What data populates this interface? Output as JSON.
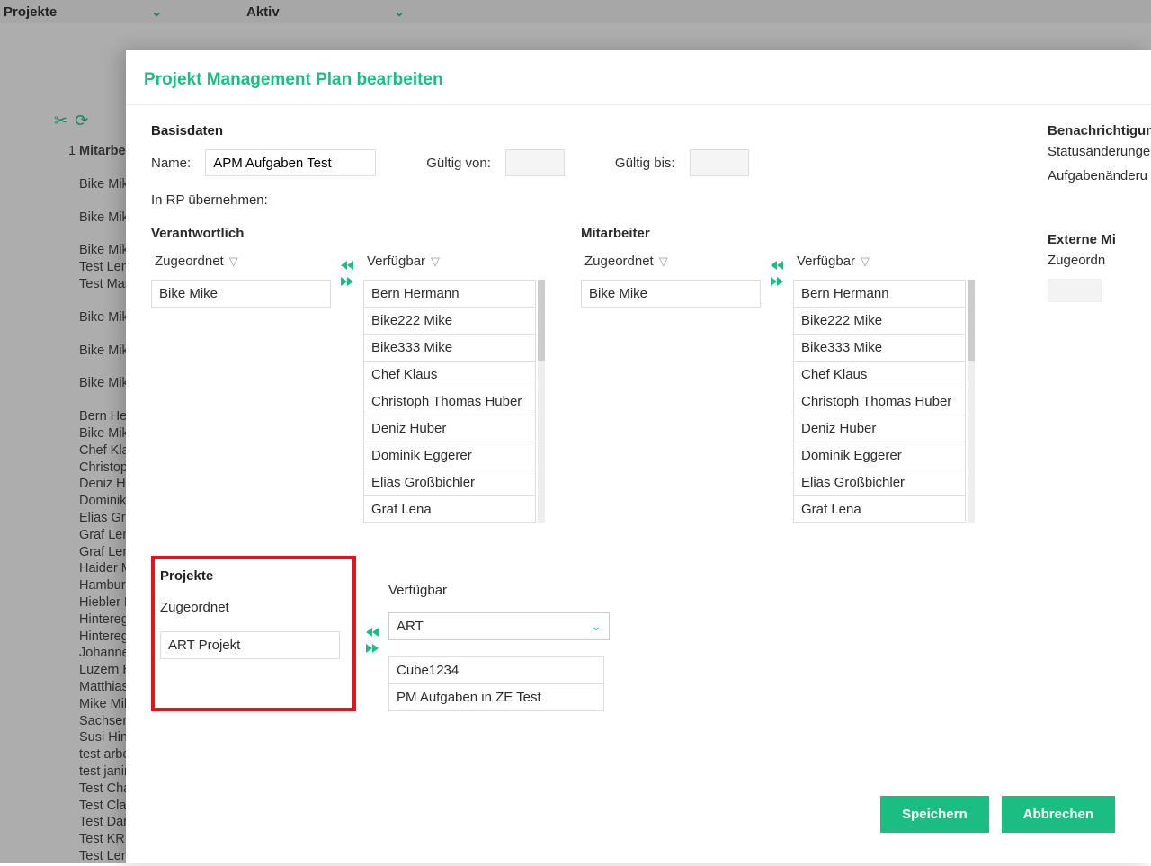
{
  "bg": {
    "dropdown1": "Projekte",
    "dropdown2": "Aktiv",
    "marker": "1",
    "header": "Mitarbeit",
    "rows1": [
      "Bike Mik",
      "",
      "Bike Mik",
      "",
      "Bike Mik",
      "Test Len",
      "Test Mar",
      "",
      "Bike Mik",
      "",
      "Bike Mik",
      "",
      "Bike Mik"
    ],
    "rows2": [
      "Bern Her",
      "Bike Mik",
      "Chef Kla",
      "Christop",
      "Deniz Hu",
      "Dominik",
      "Elias Gro",
      "Graf Len",
      "Graf Len",
      "Haider M",
      "Hamburg",
      "Hiebler D",
      "Hintereg",
      "Hintereg",
      "Johannes",
      "Luzern H",
      "Matthias",
      "Mike Mik",
      "Sachsen",
      "Susi Hin",
      "test arbe",
      "test janir",
      "Test Cha",
      "Test Clau",
      "Test Dar",
      "Test KR",
      "Test Lena"
    ]
  },
  "modal": {
    "title": "Projekt Management Plan bearbeiten",
    "basis": {
      "heading": "Basisdaten",
      "name_label": "Name:",
      "name_value": "APM Aufgaben Test",
      "valid_from_label": "Gültig von:",
      "valid_to_label": "Gültig bis:",
      "rp_label": "In RP übernehmen:"
    },
    "notif": {
      "heading": "Benachrichtigung",
      "line1": "Statusänderunge",
      "line2": "Aufgabenänderu",
      "heading2": "Externe Mi",
      "line3": "Zugeordn"
    },
    "verantwortlich": {
      "heading": "Verantwortlich",
      "assigned_label": "Zugeordnet",
      "available_label": "Verfügbar",
      "assigned": [
        "Bike Mike"
      ],
      "available": [
        "Bern Hermann",
        "Bike222 Mike",
        "Bike333 Mike",
        "Chef Klaus",
        "Christoph Thomas Huber",
        "Deniz Huber",
        "Dominik Eggerer",
        "Elias Großbichler",
        "Graf Lena"
      ]
    },
    "mitarbeiter": {
      "heading": "Mitarbeiter",
      "assigned_label": "Zugeordnet",
      "available_label": "Verfügbar",
      "assigned": [
        "Bike Mike"
      ],
      "available": [
        "Bern Hermann",
        "Bike222 Mike",
        "Bike333 Mike",
        "Chef Klaus",
        "Christoph Thomas Huber",
        "Deniz Huber",
        "Dominik Eggerer",
        "Elias Großbichler",
        "Graf Lena"
      ]
    },
    "projekte": {
      "heading": "Projekte",
      "assigned_label": "Zugeordnet",
      "available_label": "Verfügbar",
      "assigned": [
        "ART Projekt"
      ],
      "group": "ART",
      "available": [
        "Cube1234",
        "PM Aufgaben in ZE Test"
      ]
    },
    "footer": {
      "save": "Speichern",
      "cancel": "Abbrechen"
    }
  }
}
